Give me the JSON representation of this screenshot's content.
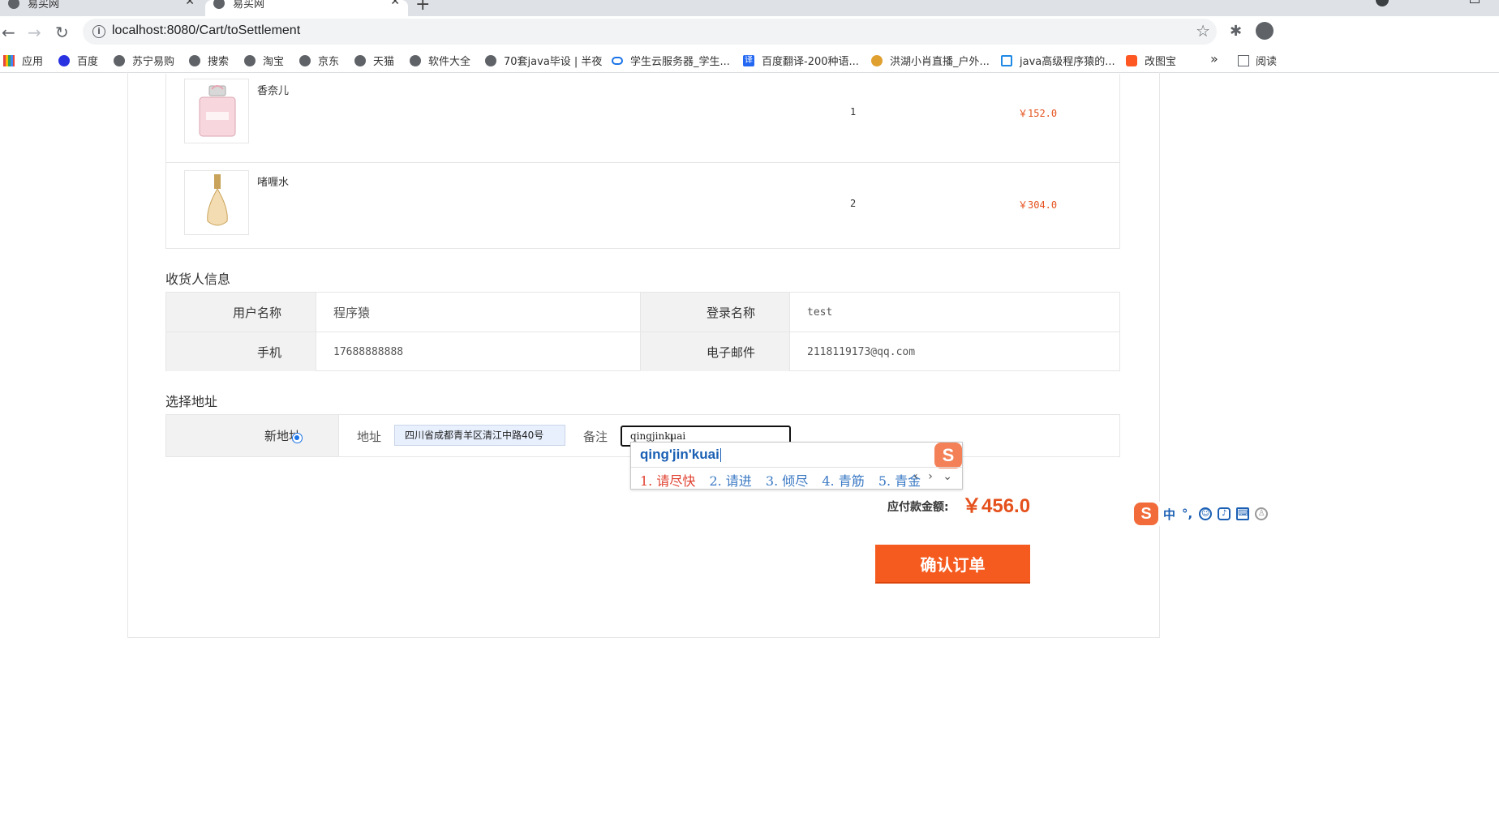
{
  "browser": {
    "tabs": [
      {
        "title": "易买网"
      },
      {
        "title": "易买网"
      }
    ],
    "new_tab": "+",
    "close_glyph": "✕",
    "url": "localhost:8080/Cart/toSettlement",
    "bookmarks": [
      {
        "label": "应用",
        "icon": "apps-grid-icon"
      },
      {
        "label": "百度",
        "icon": "baidu-paw-icon"
      },
      {
        "label": "苏宁易购",
        "icon": "globe-icon"
      },
      {
        "label": "搜索",
        "icon": "globe-icon"
      },
      {
        "label": "淘宝",
        "icon": "globe-icon"
      },
      {
        "label": "京东",
        "icon": "globe-icon"
      },
      {
        "label": "天猫",
        "icon": "globe-icon"
      },
      {
        "label": "软件大全",
        "icon": "globe-icon"
      },
      {
        "label": "70套java毕设 | 半夜",
        "icon": "globe-icon"
      },
      {
        "label": "学生云服务器_学生...",
        "icon": "cloud-icon"
      },
      {
        "label": "百度翻译-200种语...",
        "icon": "translate-icon"
      },
      {
        "label": "洪湖小肖直播_户外...",
        "icon": "live-icon"
      },
      {
        "label": "java高级程序猿的...",
        "icon": "tv-icon"
      },
      {
        "label": "改图宝",
        "icon": "gaitubao-icon"
      }
    ],
    "bookmarks_more": "»",
    "reading_list": "阅读"
  },
  "cart": {
    "items": [
      {
        "name": "香奈儿",
        "quantity": "1",
        "price": "￥152.0"
      },
      {
        "name": "啫喱水",
        "quantity": "2",
        "price": "￥304.0"
      }
    ]
  },
  "receiver": {
    "title": "收货人信息",
    "username_label": "用户名称",
    "username_value": "程序猿",
    "login_label": "登录名称",
    "login_value": "test",
    "phone_label": "手机",
    "phone_value": "17688888888",
    "email_label": "电子邮件",
    "email_value": "2118119173@qq.com"
  },
  "address": {
    "title": "选择地址",
    "new_address_label": "新地址",
    "address_label": "地址",
    "address_value": "四川省成都青羊区清江中路40号",
    "remark_label": "备注",
    "remark_value": "qingjinkuai"
  },
  "ime": {
    "pinyin": "qing'jin'kuai",
    "candidates": [
      "1. 请尽快",
      "2. 请进",
      "3. 倾尽",
      "4. 青筋",
      "5. 青金"
    ],
    "arrows": "‹ › ⌄",
    "logo": "S",
    "toolbar_mode": "中",
    "toolbar_punct": "°,"
  },
  "order": {
    "total_label": "应付款金额:",
    "total_amount": "￥456.0",
    "confirm_label": "确认订单"
  }
}
